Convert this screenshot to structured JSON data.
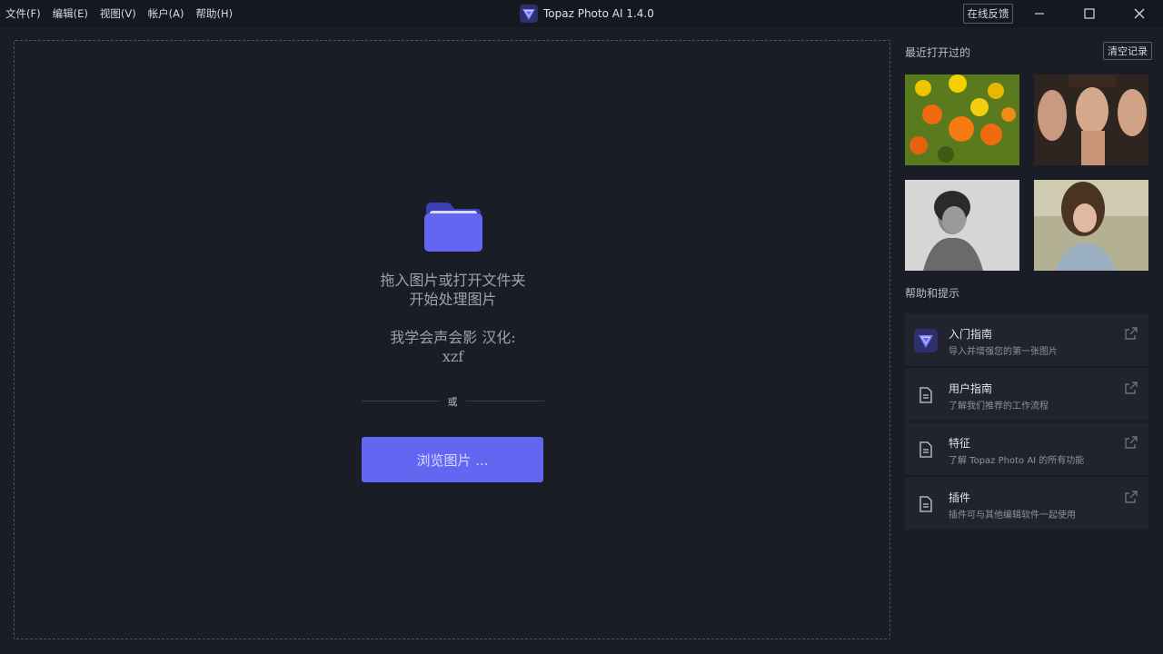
{
  "menu": [
    "文件(F)",
    "编辑(E)",
    "视图(V)",
    "帐户(A)",
    "帮助(H)"
  ],
  "app_title": "Topaz Photo AI 1.4.0",
  "feedback_label": "在线反馈",
  "window_controls": [
    "minimize-icon",
    "maximize-icon",
    "close-icon"
  ],
  "dropzone": {
    "line1": "拖入图片或打开文件夹",
    "line2": "开始处理图片",
    "line3": "我学会声会影 汉化:",
    "line4": "xzf",
    "or": "或",
    "browse_label": "浏览图片 ..."
  },
  "sidebar": {
    "recent_title": "最近打开过的",
    "clear_label": "清空记录",
    "help_title": "帮助和提示",
    "help_items": [
      {
        "title": "入门指南",
        "subtitle": "导入并增强您的第一张图片",
        "icon": "topaz-logo-icon"
      },
      {
        "title": "用户指南",
        "subtitle": "了解我们推荐的工作流程",
        "icon": "document-icon"
      },
      {
        "title": "特征",
        "subtitle": "了解 Topaz Photo AI 的所有功能",
        "icon": "document-icon"
      },
      {
        "title": "插件",
        "subtitle": "插件可与其他编辑软件一起使用",
        "icon": "document-icon"
      }
    ]
  },
  "colors": {
    "background": "#1b1d26",
    "accent": "#6366f1",
    "card": "#21232e"
  }
}
